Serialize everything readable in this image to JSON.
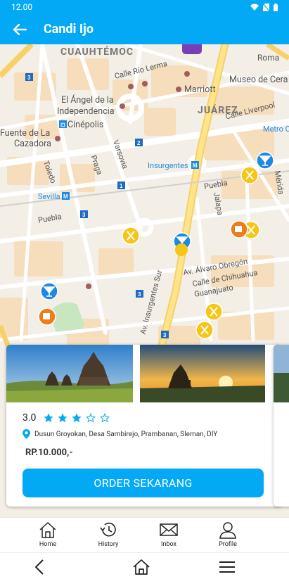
{
  "status_bar": {
    "time": "12.00"
  },
  "app_bar": {
    "title": "Candi Ijo"
  },
  "map": {
    "labels": {
      "cuauhtemoc": "CUAUHTÉMOC",
      "juarez": "JUÁREZ",
      "calle_rio_lerma": "Calle Río Lerma",
      "roma": "Roma",
      "marriott": "Marriott",
      "museo": "Museo de Cera",
      "angel": "El Ángel de la",
      "independencia": "Independencia",
      "cinepolis": "Cinépolis",
      "fuente": "Fuente de La",
      "cazadora": "Cazadora",
      "calle_liverpool": "Calle Liverpool",
      "metro": "Metro C",
      "insurgentes": "Insurgentes",
      "varsovia": "Varsovia",
      "praga": "Praga",
      "toledo": "Toledo",
      "sevilla": "Sevilla",
      "puebla": "Puebla",
      "puebla2": "Puebla",
      "jalapa": "Jalapa",
      "merida": "Mérida",
      "alvaro_obregon": "Av. Álvaro Obregón",
      "chihuahua": "Calle de Chihuahua",
      "guanajuato": "Guanajuato",
      "av_insurgentes_sur": "Av. Insurgentes Sur"
    },
    "shields": [
      "3",
      "2",
      "1",
      "3",
      "3",
      "3"
    ]
  },
  "card": {
    "rating": "3.0",
    "stars_filled": 3,
    "stars_total": 5,
    "address": "Dusun Groyokan, Desa Sambirejo, Prambanan, Sleman, DIY",
    "price": "RP.10.000,-",
    "order_button": "ORDER SEKARANG"
  },
  "bottom_nav": {
    "home": "Home",
    "history": "History",
    "inbox": "Inbox",
    "profile": "Profile"
  },
  "colors": {
    "primary": "#03a9f4",
    "star": "#03a9f4"
  }
}
